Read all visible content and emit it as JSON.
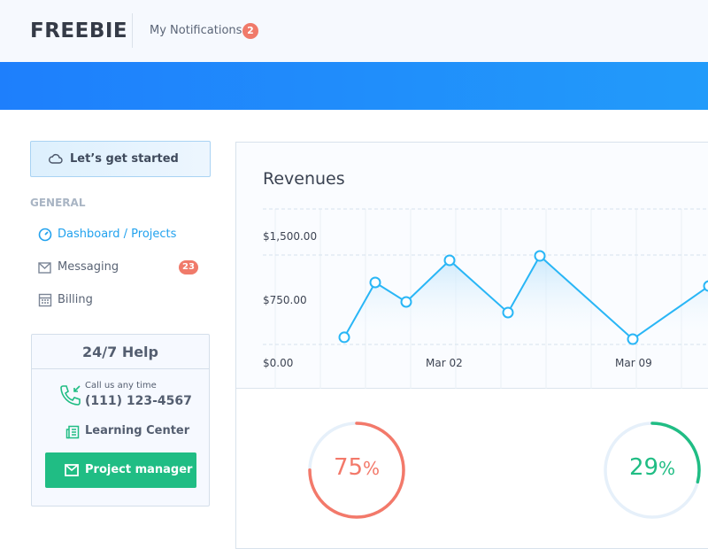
{
  "header": {
    "logo": "FREEBIE",
    "notifications_label": "My Notifications",
    "notifications_count": "2"
  },
  "sidebar": {
    "start_button": "Let’s get started",
    "section": "GENERAL",
    "items": [
      {
        "label": "Dashboard / Projects",
        "active": true
      },
      {
        "label": "Messaging",
        "badge": "23"
      },
      {
        "label": "Billing"
      }
    ],
    "help": {
      "title": "24/7 Help",
      "call_label": "Call us any time",
      "phone": "(111) 123-4567",
      "learning": "Learning Center",
      "button": "Project manager"
    }
  },
  "revenues": {
    "title": "Revenues",
    "chart_data": {
      "type": "line",
      "title": "Revenues",
      "y_ticks": [
        "$1,500.00",
        "$750.00",
        "$0.00"
      ],
      "ylim": [
        0,
        1500
      ],
      "x_ticks": [
        "Mar 02",
        "Mar 09"
      ],
      "values": [
        120,
        1040,
        713,
        1411,
        535,
        1485,
        89,
        980
      ],
      "color": "#29b6f6"
    }
  },
  "stats": [
    {
      "value": "75",
      "unit": "%",
      "fraction": 0.75,
      "color": "#f3796a"
    },
    {
      "value": "29",
      "unit": "%",
      "fraction": 0.29,
      "color": "#20bd84"
    }
  ]
}
